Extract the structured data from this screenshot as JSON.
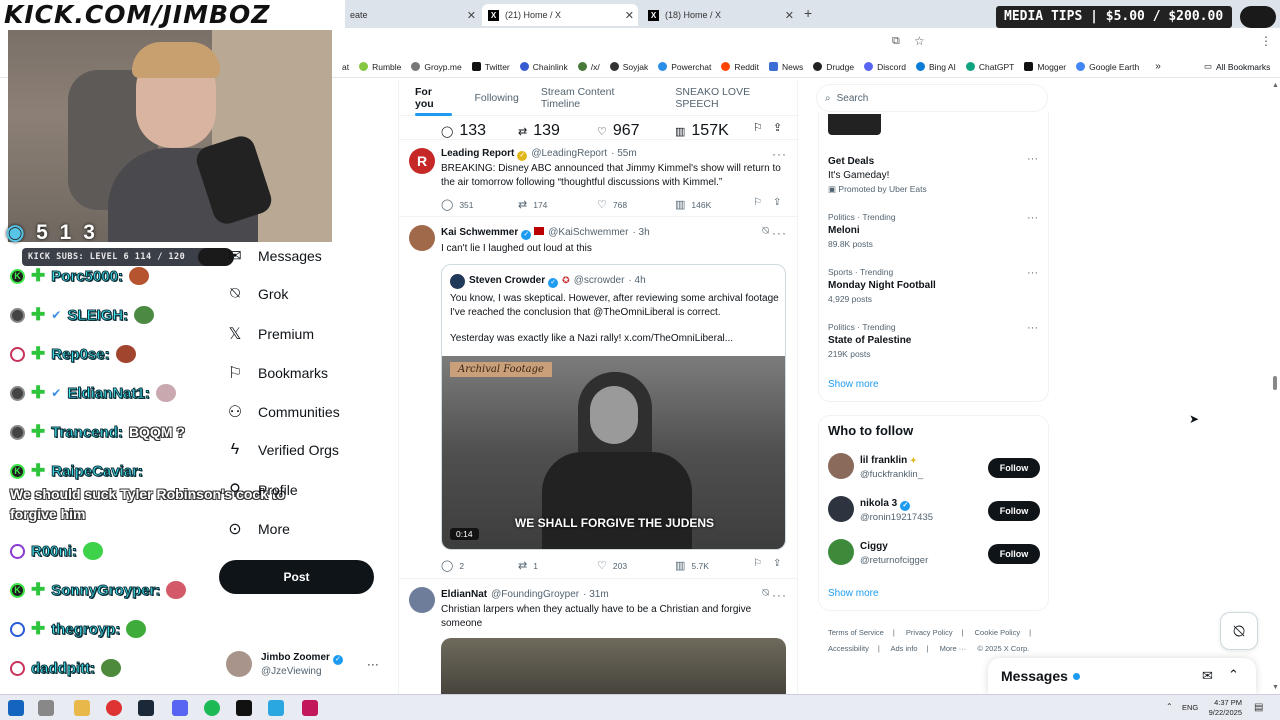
{
  "overlay": {
    "title": "KICK.COM/JIMBOZ",
    "viewer_count": "5 1 3",
    "subs_bar": "KICK SUBS: LEVEL 6 114 / 120",
    "media_tips": "MEDIA TIPS | $5.00 / $200.00"
  },
  "chat": [
    {
      "user": "Porc5000:",
      "message": ""
    },
    {
      "user": "SLEIGH:",
      "message": ""
    },
    {
      "user": "Rep0se:",
      "message": ""
    },
    {
      "user": "EldianNat1:",
      "message": ""
    },
    {
      "user": "Trancend:",
      "message": "BQQM ?"
    },
    {
      "user": "RaipeCaviar:",
      "message": "We should suck Tyler Robinson's cock to forgive him"
    },
    {
      "user": "R00ni:",
      "message": ""
    },
    {
      "user": "SonnyGroyper:",
      "message": ""
    },
    {
      "user": "thegroyp:",
      "message": ""
    },
    {
      "user": "daddpitt:",
      "message": ""
    }
  ],
  "browser": {
    "tabs": [
      {
        "label": "eate"
      },
      {
        "label": "(21) Home / X"
      },
      {
        "label": "(18) Home / X"
      }
    ],
    "bookmarks": [
      "at",
      "Rumble",
      "Groyp.me",
      "Twitter",
      "Chainlink",
      "/x/",
      "Soyjak",
      "Powerchat",
      "Reddit",
      "News",
      "Drudge",
      "Discord",
      "Bing AI",
      "ChatGPT",
      "Mogger",
      "Google Earth"
    ],
    "all_bookmarks": "All Bookmarks"
  },
  "nav": {
    "items": [
      {
        "label": "Messages",
        "icon": "envelope-icon"
      },
      {
        "label": "Grok",
        "icon": "grok-icon"
      },
      {
        "label": "Premium",
        "icon": "x-icon"
      },
      {
        "label": "Bookmarks",
        "icon": "bookmark-icon"
      },
      {
        "label": "Communities",
        "icon": "people-icon"
      },
      {
        "label": "Verified Orgs",
        "icon": "lightning-icon"
      },
      {
        "label": "Profile",
        "icon": "person-icon"
      },
      {
        "label": "More",
        "icon": "more-circle-icon"
      }
    ],
    "post_label": "Post",
    "account": {
      "name": "Jimbo Zoomer",
      "handle": "@JzeViewing"
    }
  },
  "feed": {
    "tabs": [
      "For you",
      "Following",
      "Stream Content Timeline",
      "SNEAKO LOVE SPEECH"
    ],
    "top_actions": {
      "replies": "133",
      "reposts": "139",
      "likes": "967",
      "views": "157K"
    },
    "tweets": [
      {
        "name": "Leading Report",
        "handle": "@LeadingReport",
        "time": "· 55m",
        "text": "BREAKING: Disney ABC announced that Jimmy Kimmel's show will return to the air tomorrow following “thoughtful discussions with Kimmel.”",
        "replies": "351",
        "reposts": "174",
        "likes": "768",
        "views": "146K"
      },
      {
        "name": "Kai Schwemmer",
        "handle": "@KaiSchwemmer",
        "time": "· 3h",
        "text": "I can't lie I laughed out loud at this",
        "quote": {
          "name": "Steven Crowder",
          "handle": "@scrowder",
          "time": "· 4h",
          "text": "You know, I was skeptical. However, after reviewing some archival footage I've reached the conclusion that @TheOmniLiberal is correct.",
          "text2": "Yesterday was exactly like a Nazi rally!  x.com/TheOmniLiberal...",
          "video_tag": "Archival Footage",
          "video_caption": "WE SHALL FORGIVE THE JUDENS",
          "duration": "0:14"
        },
        "replies": "2",
        "reposts": "1",
        "likes": "203",
        "views": "5.7K"
      },
      {
        "name": "EldianNat",
        "handle": "@FoundingGroyper",
        "time": "· 31m",
        "text": "Christian larpers when they actually have to be a Christian and forgive someone"
      }
    ]
  },
  "sidebar": {
    "search_placeholder": "Search",
    "ad": {
      "title": "Get Deals",
      "subtitle": "It's Gameday!",
      "promoted": "Promoted by Uber Eats"
    },
    "trends": [
      {
        "category": "Politics · Trending",
        "name": "Meloni",
        "count": "89.8K posts"
      },
      {
        "category": "Sports · Trending",
        "name": "Monday Night Football",
        "count": "4,929 posts"
      },
      {
        "category": "Politics · Trending",
        "name": "State of Palestine",
        "count": "219K posts"
      }
    ],
    "show_more": "Show more",
    "who_to_follow_title": "Who to follow",
    "who_to_follow": [
      {
        "name": "lil franklin",
        "handle": "@fuckfranklin_",
        "button": "Follow"
      },
      {
        "name": "nikola 3",
        "handle": "@ronin19217435",
        "button": "Follow"
      },
      {
        "name": "Ciggy",
        "handle": "@returnofcigger",
        "button": "Follow"
      }
    ],
    "footer": [
      "Terms of Service",
      "Privacy Policy",
      "Cookie Policy",
      "Accessibility",
      "Ads info",
      "More ···",
      "© 2025 X Corp."
    ]
  },
  "messages_drawer": "Messages",
  "taskbar": {
    "lang": "ENG",
    "time": "4:37 PM",
    "date": "9/22/2025"
  }
}
